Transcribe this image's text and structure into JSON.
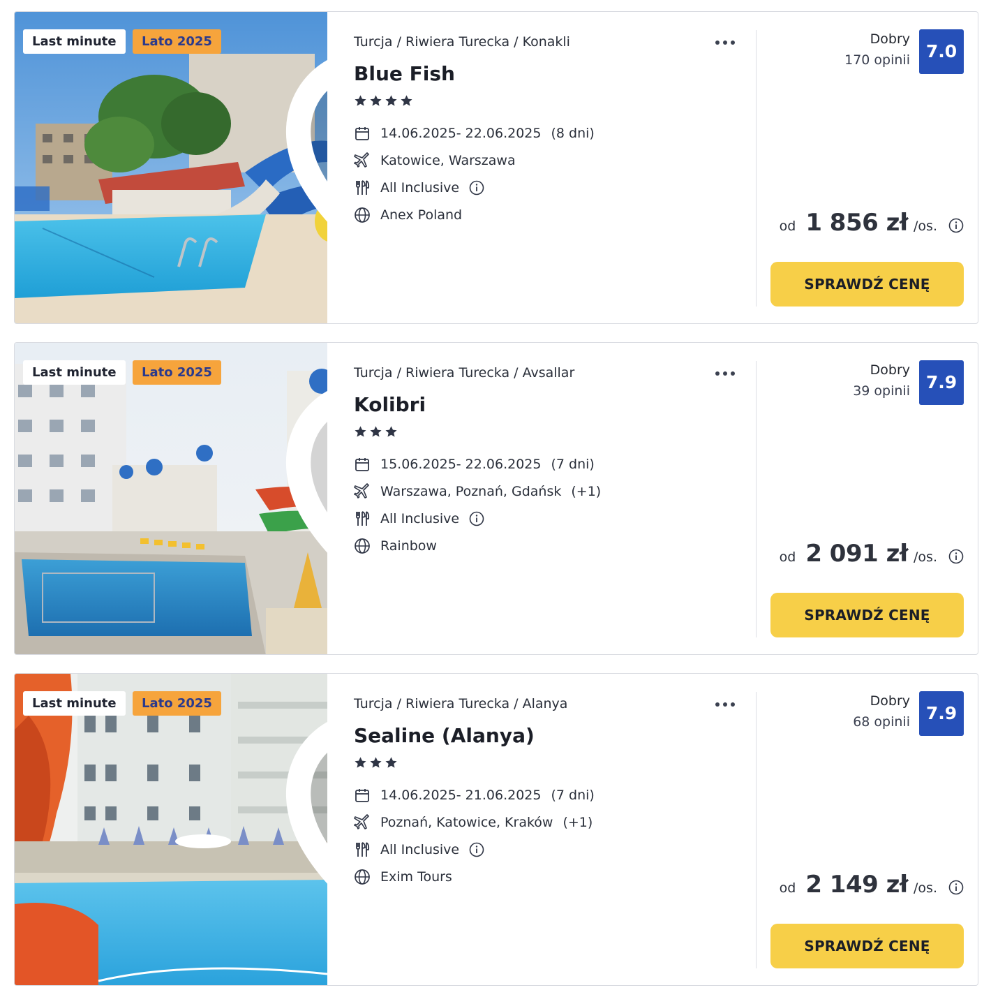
{
  "offers": [
    {
      "badge_last_minute": "Last minute",
      "badge_season": "Lato 2025",
      "breadcrumb": "Turcja / Riwiera Turecka / Konakli",
      "hotel_name": "Blue Fish",
      "stars": 4,
      "dates": "14.06.2025- 22.06.2025",
      "duration": "(8 dni)",
      "departures": "Katowice, Warszawa",
      "departures_extra": "",
      "board": "All Inclusive",
      "operator": "Anex Poland",
      "rating_label": "Dobry",
      "rating_count": "170 opinii",
      "score": "7.0",
      "price_prefix": "od",
      "price": "1 856 zł",
      "price_unit": "/os.",
      "cta": "SPRAWDŹ CENĘ",
      "favorite_style": "outline"
    },
    {
      "badge_last_minute": "Last minute",
      "badge_season": "Lato 2025",
      "breadcrumb": "Turcja / Riwiera Turecka / Avsallar",
      "hotel_name": "Kolibri",
      "stars": 3,
      "dates": "15.06.2025- 22.06.2025",
      "duration": "(7 dni)",
      "departures": "Warszawa, Poznań, Gdańsk",
      "departures_extra": "(+1)",
      "board": "All Inclusive",
      "operator": "Rainbow",
      "rating_label": "Dobry",
      "rating_count": "39 opinii",
      "score": "7.9",
      "price_prefix": "od",
      "price": "2 091 zł",
      "price_unit": "/os.",
      "cta": "SPRAWDŹ CENĘ",
      "favorite_style": "filled"
    },
    {
      "badge_last_minute": "Last minute",
      "badge_season": "Lato 2025",
      "breadcrumb": "Turcja / Riwiera Turecka / Alanya",
      "hotel_name": "Sealine (Alanya)",
      "stars": 3,
      "dates": "14.06.2025- 21.06.2025",
      "duration": "(7 dni)",
      "departures": "Poznań, Katowice, Kraków",
      "departures_extra": "(+1)",
      "board": "All Inclusive",
      "operator": "Exim Tours",
      "rating_label": "Dobry",
      "rating_count": "68 opinii",
      "score": "7.9",
      "price_prefix": "od",
      "price": "2 149 zł",
      "price_unit": "/os.",
      "cta": "SPRAWDŹ CENĘ",
      "favorite_style": "outline"
    }
  ],
  "colors": {
    "score_bg": "#2650b8",
    "cta_bg": "#f7cf48",
    "season_badge_bg": "#f6a43c",
    "season_badge_text": "#2b3a8c"
  },
  "icons": {
    "favorite": "heart-icon",
    "more": "more-dots-icon",
    "calendar": "calendar-icon",
    "flight": "plane-icon",
    "board": "cutlery-icon",
    "info": "info-icon",
    "operator": "globe-icon",
    "star": "star-icon"
  }
}
